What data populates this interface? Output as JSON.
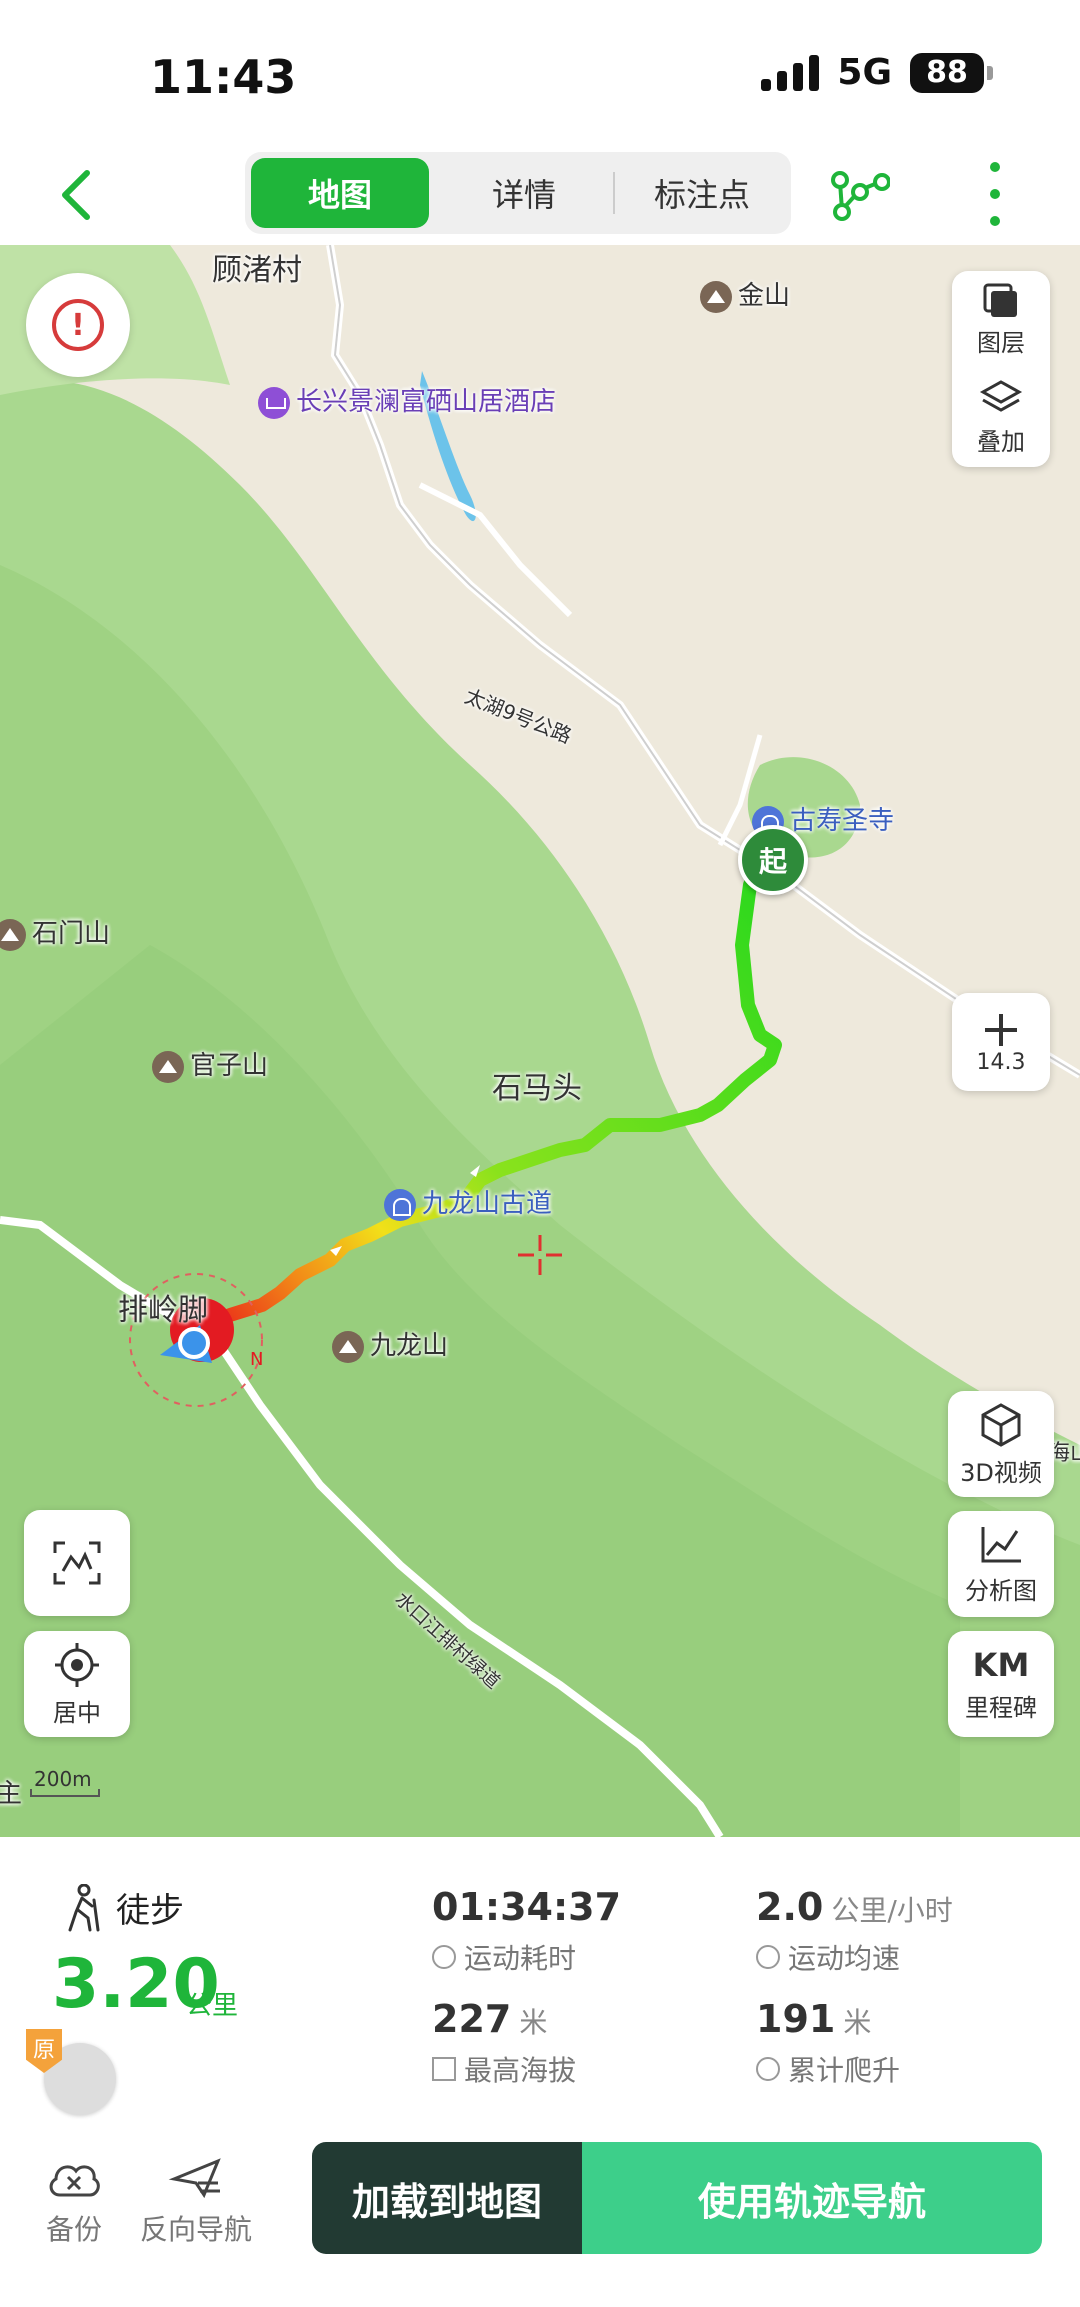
{
  "status": {
    "time": "11:43",
    "network": "5G",
    "battery": "88"
  },
  "header": {
    "tabs": [
      {
        "label": "地图"
      },
      {
        "label": "详情"
      },
      {
        "label": "标注点"
      }
    ]
  },
  "map": {
    "places": {
      "village": "顾渚村",
      "jinshan": "金山",
      "hotel": "长兴景澜富硒山居酒店",
      "road1": "太湖9号公路",
      "temple": "古寿圣寺",
      "shimenshan": "石门山",
      "guanzishan": "官子山",
      "shimatou": "石马头",
      "ancient_road": "九龙山古道",
      "pailing": "排岭脚",
      "jiulongshan": "九龙山",
      "road2": "水口江排村绿道",
      "edge_left": "主",
      "edge_right": "海山"
    },
    "start_marker": "起",
    "controls": {
      "layers": "图层",
      "overlay": "叠加",
      "zoom_value": "14.3",
      "video3d": "3D视频",
      "analysis": "分析图",
      "milestone_title": "KM",
      "milestone": "里程碑",
      "center": "居中"
    },
    "scale": "200m"
  },
  "summary": {
    "activity": "徒步",
    "distance": "3.20",
    "distance_unit": "公里",
    "badge": "原",
    "duration": "01:34:37",
    "duration_label": "运动耗时",
    "speed": "2.0",
    "speed_unit": "公里/小时",
    "speed_label": "运动均速",
    "max_alt": "227",
    "max_alt_unit": "米",
    "max_alt_label": "最高海拔",
    "climb": "191",
    "climb_unit": "米",
    "climb_label": "累计爬升"
  },
  "actions": {
    "backup": "备份",
    "reverse": "反向导航",
    "load": "加载到地图",
    "navigate": "使用轨迹导航"
  },
  "colors": {
    "accent": "#1fb53a",
    "nav_button": "#3dcf8a",
    "load_button": "#223a33"
  }
}
